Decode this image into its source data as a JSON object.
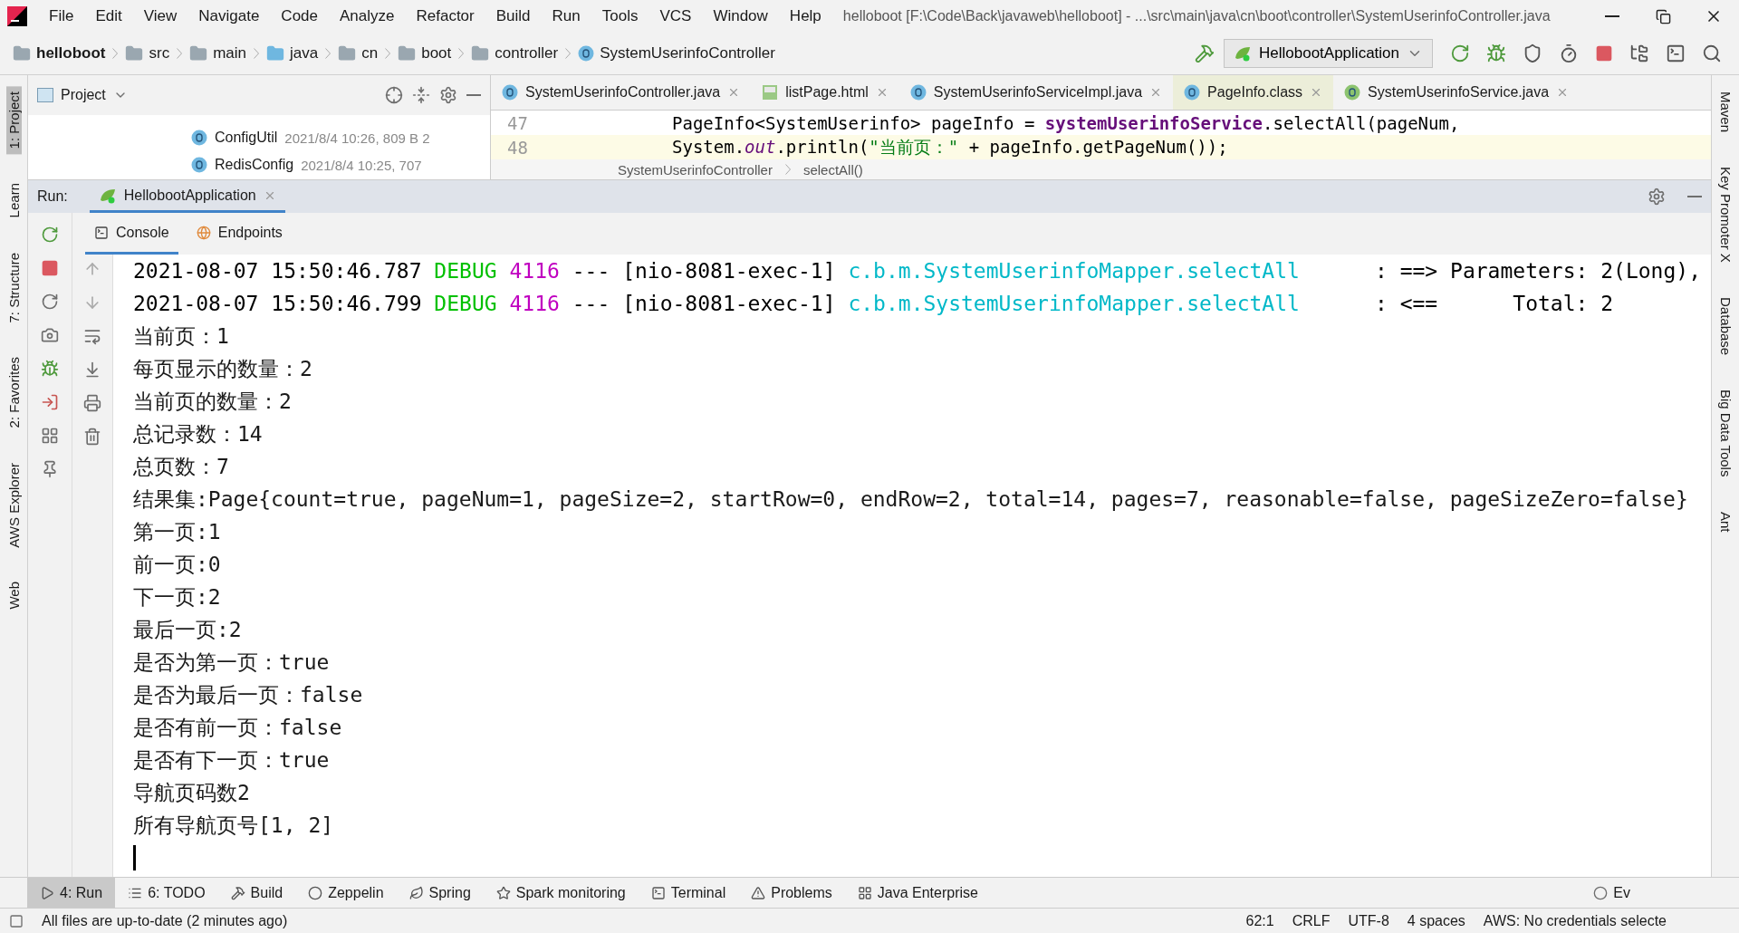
{
  "window": {
    "title": "helloboot [F:\\Code\\Back\\javaweb\\helloboot] - ...\\src\\main\\java\\cn\\boot\\controller\\SystemUserinfoController.java"
  },
  "menu": [
    "File",
    "Edit",
    "View",
    "Navigate",
    "Code",
    "Analyze",
    "Refactor",
    "Build",
    "Run",
    "Tools",
    "VCS",
    "Window",
    "Help"
  ],
  "breadcrumbs": [
    {
      "label": "helloboot",
      "kind": "project"
    },
    {
      "label": "src",
      "kind": "folder"
    },
    {
      "label": "main",
      "kind": "folder"
    },
    {
      "label": "java",
      "kind": "source"
    },
    {
      "label": "cn",
      "kind": "package"
    },
    {
      "label": "boot",
      "kind": "package"
    },
    {
      "label": "controller",
      "kind": "folder"
    },
    {
      "label": "SystemUserinfoController",
      "kind": "class"
    }
  ],
  "run_configuration": "HellobootApplication",
  "left_stripe": [
    "1: Project",
    "Learn",
    "7: Structure",
    "2: Favorites",
    "AWS Explorer",
    "Web"
  ],
  "right_stripe": [
    "Maven",
    "Key Promoter X",
    "Database",
    "Big Data Tools",
    "Ant"
  ],
  "project_panel": {
    "title": "Project",
    "files": [
      {
        "name": "ConfigUtil",
        "meta": "2021/8/4 10:26, 809 B 2"
      },
      {
        "name": "RedisConfig",
        "meta": "2021/8/4 10:25, 707"
      }
    ]
  },
  "editor_tabs": [
    {
      "label": "SystemUserinfoController.java",
      "kind": "class",
      "selected": false
    },
    {
      "label": "listPage.html",
      "kind": "html",
      "selected": false
    },
    {
      "label": "SystemUserinfoServiceImpl.java",
      "kind": "class",
      "selected": false
    },
    {
      "label": "PageInfo.class",
      "kind": "class",
      "selected": true
    },
    {
      "label": "SystemUserinfoService.java",
      "kind": "interface",
      "selected": false
    }
  ],
  "editor_lines": [
    {
      "number": "47",
      "tokens": [
        {
          "text": "PageInfo<SystemUserinfo> pageInfo = ",
          "kind": "plain"
        },
        {
          "text": "systemUserinfoService",
          "kind": "field"
        },
        {
          "text": ".selectAll(pageNum,",
          "kind": "plain"
        }
      ]
    },
    {
      "number": "48",
      "tokens": [
        {
          "text": "System.",
          "kind": "plain"
        },
        {
          "text": "out",
          "kind": "static"
        },
        {
          "text": ".println(",
          "kind": "plain"
        },
        {
          "text": "\"当前页：\"",
          "kind": "string"
        },
        {
          "text": " + pageInfo.getPageNum());",
          "kind": "plain"
        }
      ]
    }
  ],
  "editor_breadcrumbs": [
    "SystemUserinfoController",
    "selectAll()"
  ],
  "run_panel": {
    "label": "Run:",
    "tab": "HellobootApplication"
  },
  "console_tabs": [
    {
      "label": "Console",
      "selected": true
    },
    {
      "label": "Endpoints",
      "selected": false
    }
  ],
  "console_lines": [
    {
      "kind": "log",
      "time": "2021-08-07 15:50:46.787",
      "level": "DEBUG",
      "pid": "4116",
      "separator": "---",
      "thread": "[nio-8081-exec-1]",
      "logger": "c.b.m.SystemUserinfoMapper.selectAll",
      "message": ": ==> Parameters: 2(Long),"
    },
    {
      "kind": "log",
      "time": "2021-08-07 15:50:46.799",
      "level": "DEBUG",
      "pid": "4116",
      "separator": "---",
      "thread": "[nio-8081-exec-1]",
      "logger": "c.b.m.SystemUserinfoMapper.selectAll",
      "message": ": <==      Total: 2"
    },
    {
      "kind": "text",
      "text": "当前页：1"
    },
    {
      "kind": "text",
      "text": "每页显示的数量：2"
    },
    {
      "kind": "text",
      "text": "当前页的数量：2"
    },
    {
      "kind": "text",
      "text": "总记录数：14"
    },
    {
      "kind": "text",
      "text": "总页数：7"
    },
    {
      "kind": "text",
      "text": "结果集:Page{count=true, pageNum=1, pageSize=2, startRow=0, endRow=2, total=14, pages=7, reasonable=false, pageSizeZero=false}"
    },
    {
      "kind": "text",
      "text": "第一页:1"
    },
    {
      "kind": "text",
      "text": "前一页:0"
    },
    {
      "kind": "text",
      "text": "下一页:2"
    },
    {
      "kind": "text",
      "text": "最后一页:2"
    },
    {
      "kind": "text",
      "text": "是否为第一页：true"
    },
    {
      "kind": "text",
      "text": "是否为最后一页：false"
    },
    {
      "kind": "text",
      "text": "是否有前一页：false"
    },
    {
      "kind": "text",
      "text": "是否有下一页：true"
    },
    {
      "kind": "text",
      "text": "导航页码数2"
    },
    {
      "kind": "text",
      "text": "所有导航页号[1, 2]"
    }
  ],
  "tool_tabs": [
    {
      "label": "4: Run",
      "kind": "run",
      "selected": true
    },
    {
      "label": "6: TODO",
      "kind": "todo",
      "selected": false
    },
    {
      "label": "Build",
      "kind": "build",
      "selected": false
    },
    {
      "label": "Zeppelin",
      "kind": "zeppelin",
      "selected": false
    },
    {
      "label": "Spring",
      "kind": "spring",
      "selected": false
    },
    {
      "label": "Spark monitoring",
      "kind": "spark",
      "selected": false
    },
    {
      "label": "Terminal",
      "kind": "terminal",
      "selected": false
    },
    {
      "label": "Problems",
      "kind": "problems",
      "selected": false
    },
    {
      "label": "Java Enterprise",
      "kind": "enterprise",
      "selected": false
    }
  ],
  "event_log": "Ev",
  "status_bar": {
    "message": "All files are up-to-date (2 minutes ago)",
    "items": [
      "62:1",
      "CRLF",
      "UTF-8",
      "4 spaces",
      "AWS: No credentials selecte"
    ]
  }
}
